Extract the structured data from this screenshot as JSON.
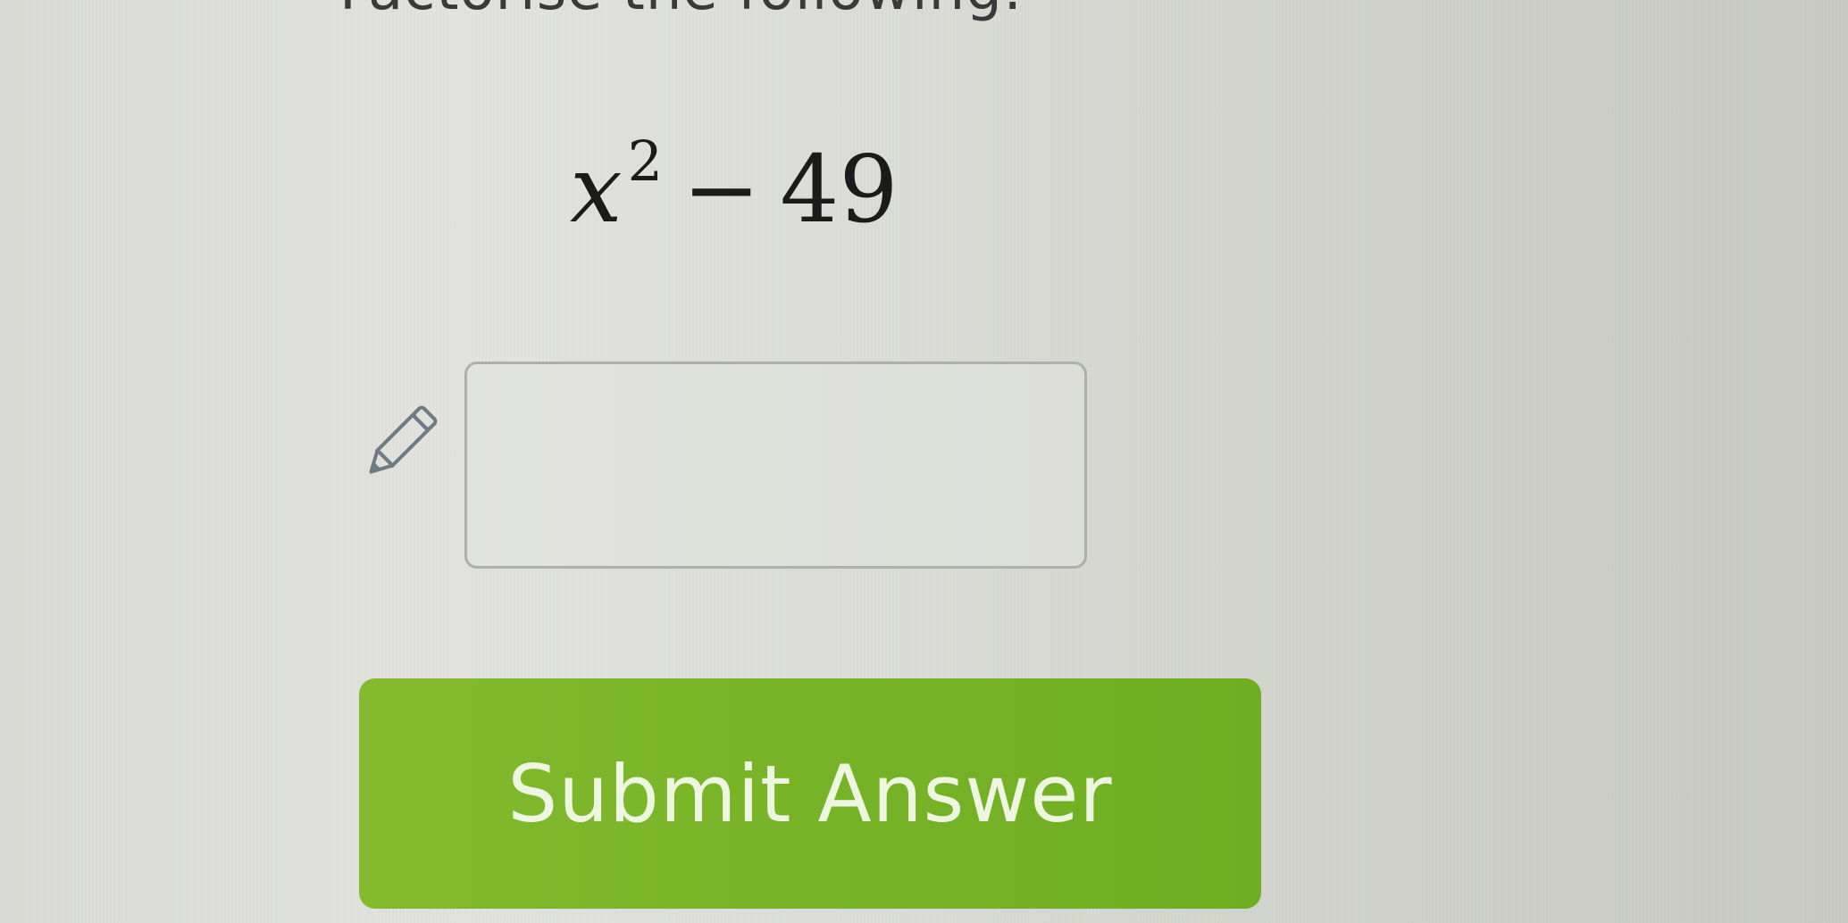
{
  "question": {
    "heading": "Factorise the following:",
    "expression": {
      "variable": "x",
      "exponent": "2",
      "operator": "−",
      "constant": "49"
    }
  },
  "answer": {
    "input_value": "",
    "placeholder": "",
    "icon": "pencil-icon"
  },
  "actions": {
    "submit_label": "Submit Answer"
  },
  "colors": {
    "submit_button": "#79b427",
    "input_border": "#aeb0ab",
    "background": "#dcddd8"
  }
}
